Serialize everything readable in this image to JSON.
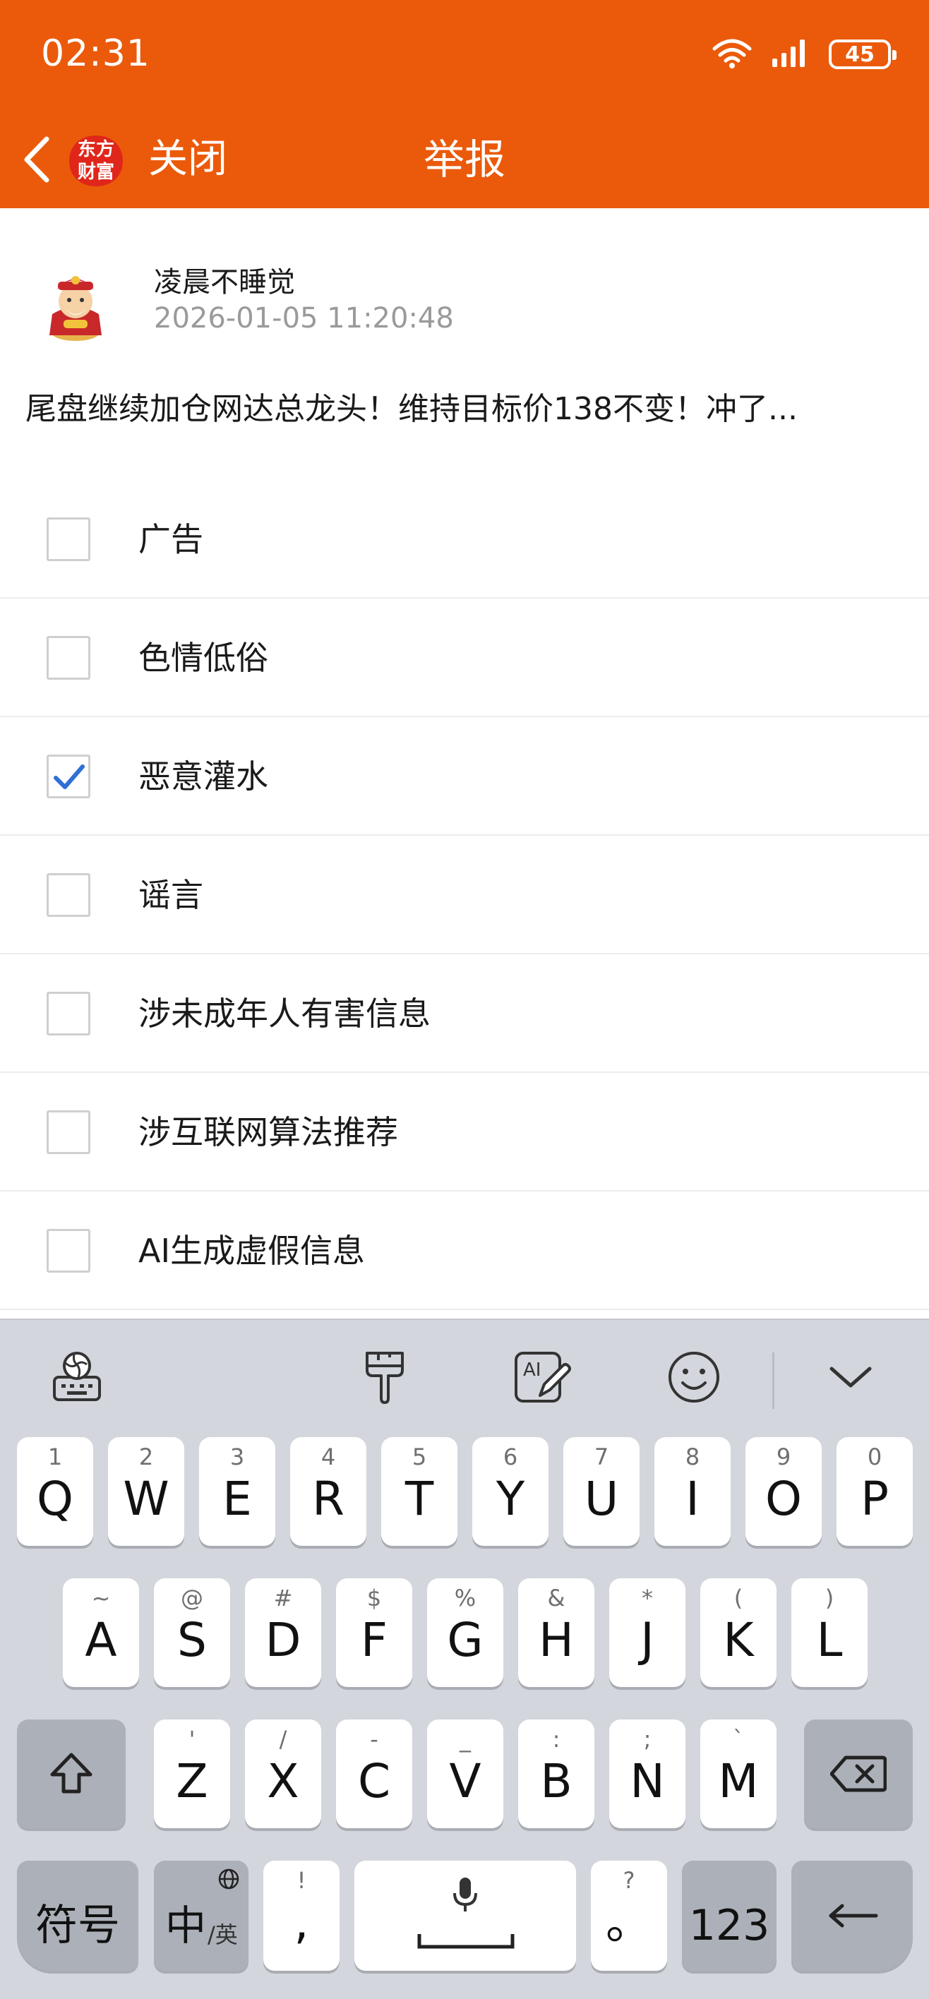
{
  "status_bar": {
    "time": "02:31",
    "battery": "45",
    "icons": [
      "wifi-icon",
      "signal-icon",
      "battery-icon"
    ]
  },
  "nav": {
    "back_icon": "chevron-left-icon",
    "logo_text": [
      "东方",
      "财富"
    ],
    "close_label": "关闭",
    "title": "举报"
  },
  "post": {
    "user_name": "凌晨不睡觉",
    "time": "2026-01-05 11:20:48",
    "content": "尾盘继续加仓网达总龙头！维持目标价138不变！冲了..."
  },
  "options": [
    {
      "label": "广告",
      "checked": false
    },
    {
      "label": "色情低俗",
      "checked": false
    },
    {
      "label": "恶意灌水",
      "checked": true
    },
    {
      "label": "谣言",
      "checked": false
    },
    {
      "label": "涉未成年人有害信息",
      "checked": false
    },
    {
      "label": "涉互联网算法推荐",
      "checked": false
    },
    {
      "label": "AI生成虚假信息",
      "checked": false
    }
  ],
  "keyboard": {
    "toolbar": [
      "globe-keyboard-icon",
      "paint-brush-icon",
      "ai-handwriting-icon",
      "emoji-icon",
      "chevron-down-icon"
    ],
    "row1": [
      {
        "main": "Q",
        "sec": "1"
      },
      {
        "main": "W",
        "sec": "2"
      },
      {
        "main": "E",
        "sec": "3"
      },
      {
        "main": "R",
        "sec": "4"
      },
      {
        "main": "T",
        "sec": "5"
      },
      {
        "main": "Y",
        "sec": "6"
      },
      {
        "main": "U",
        "sec": "7"
      },
      {
        "main": "I",
        "sec": "8"
      },
      {
        "main": "O",
        "sec": "9"
      },
      {
        "main": "P",
        "sec": "0"
      }
    ],
    "row2": [
      {
        "main": "A",
        "sec": "~"
      },
      {
        "main": "S",
        "sec": "@"
      },
      {
        "main": "D",
        "sec": "#"
      },
      {
        "main": "F",
        "sec": "$"
      },
      {
        "main": "G",
        "sec": "%"
      },
      {
        "main": "H",
        "sec": "&"
      },
      {
        "main": "J",
        "sec": "*"
      },
      {
        "main": "K",
        "sec": "("
      },
      {
        "main": "L",
        "sec": ")"
      }
    ],
    "row3": [
      {
        "main": "Z",
        "sec": "'"
      },
      {
        "main": "X",
        "sec": "/"
      },
      {
        "main": "C",
        "sec": "-"
      },
      {
        "main": "V",
        "sec": "_"
      },
      {
        "main": "B",
        "sec": ":"
      },
      {
        "main": "N",
        "sec": ";"
      },
      {
        "main": "M",
        "sec": "`"
      }
    ],
    "symbols_label": "符号",
    "lang_main": "中",
    "lang_sub": "/英",
    "comma_main": ",",
    "comma_sec": "!",
    "period_main": "。",
    "period_sec": "?",
    "numbers_label": "123"
  }
}
